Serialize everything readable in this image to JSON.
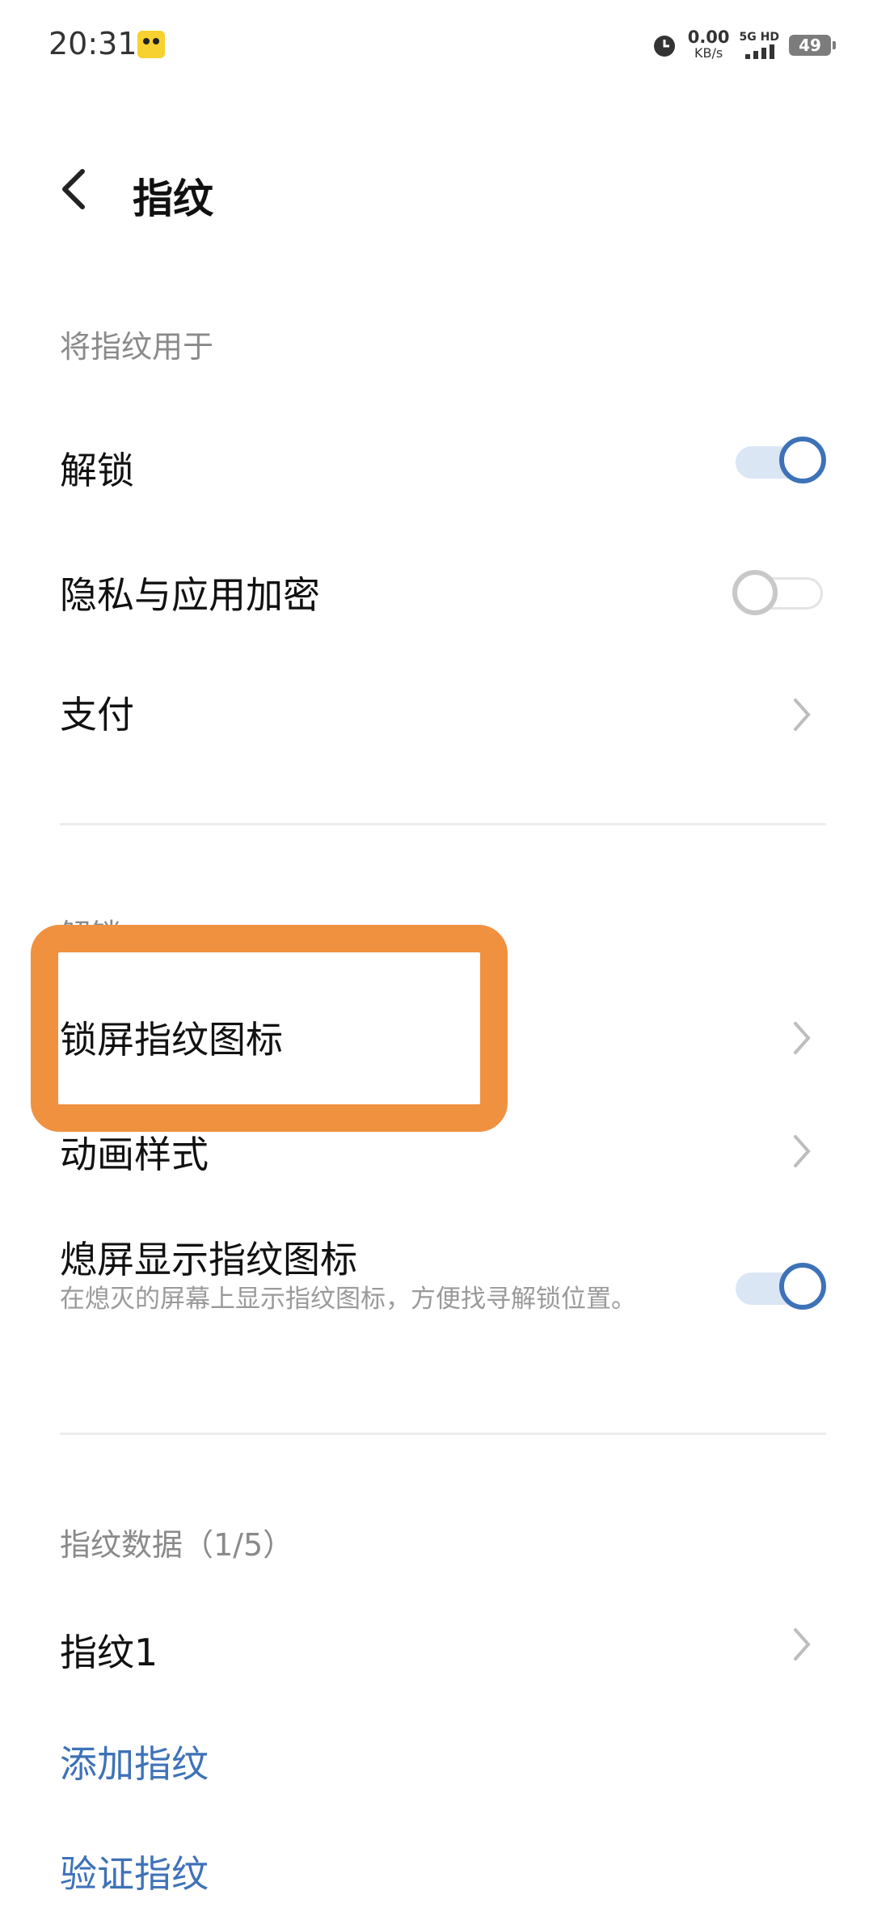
{
  "status_bar": {
    "time": "20:31",
    "net_speed_value": "0.00",
    "net_speed_unit": "KB/s",
    "network_label": "5G HD",
    "battery": "49"
  },
  "header": {
    "title": "指纹"
  },
  "sections": {
    "use_for": {
      "label": "将指纹用于",
      "items": [
        {
          "label": "解锁",
          "toggle": "on"
        },
        {
          "label": "隐私与应用加密",
          "toggle": "off"
        },
        {
          "label": "支付"
        }
      ]
    },
    "unlock": {
      "label": "解锁",
      "items": [
        {
          "label": "锁屏指纹图标"
        },
        {
          "label": "动画样式"
        },
        {
          "label": "熄屏显示指纹图标",
          "description": "在熄灭的屏幕上显示指纹图标，方便找寻解锁位置。",
          "toggle": "on"
        }
      ]
    },
    "fingerprint_data": {
      "label": "指纹数据（1/5）",
      "items": [
        {
          "label": "指纹1"
        }
      ],
      "actions": [
        "添加指纹",
        "验证指纹"
      ]
    }
  },
  "colors": {
    "accent": "#3e72b8",
    "highlight": "#f0913f"
  }
}
